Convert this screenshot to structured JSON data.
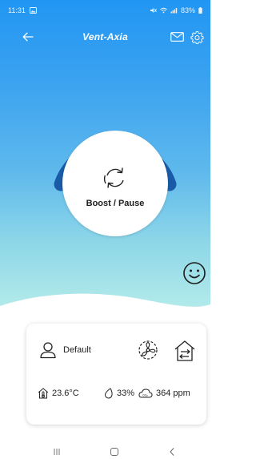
{
  "status_bar": {
    "time": "11:31",
    "battery": "83%"
  },
  "app_bar": {
    "brand": "Vent-Axia"
  },
  "boost": {
    "label": "Boost / Pause"
  },
  "card": {
    "mode_label": "Default",
    "temperature": "23.6°C",
    "humidity": "33%",
    "co2": "364 ppm"
  },
  "colors": {
    "accent_dark_blue": "#1a5ba8",
    "gradient_top": "#2196f3",
    "gradient_bottom": "#b6ecea"
  },
  "icons": {
    "back": "arrow-left-icon",
    "mail": "mail-icon",
    "settings": "gear-icon",
    "boost": "cycle-arrows-icon",
    "mood": "smiley-icon",
    "user": "user-icon",
    "fan": "fan-icon",
    "house": "house-airflow-icon",
    "temperature": "house-thermometer-icon",
    "humidity": "droplet-icon",
    "co2": "co2-cloud-icon"
  }
}
